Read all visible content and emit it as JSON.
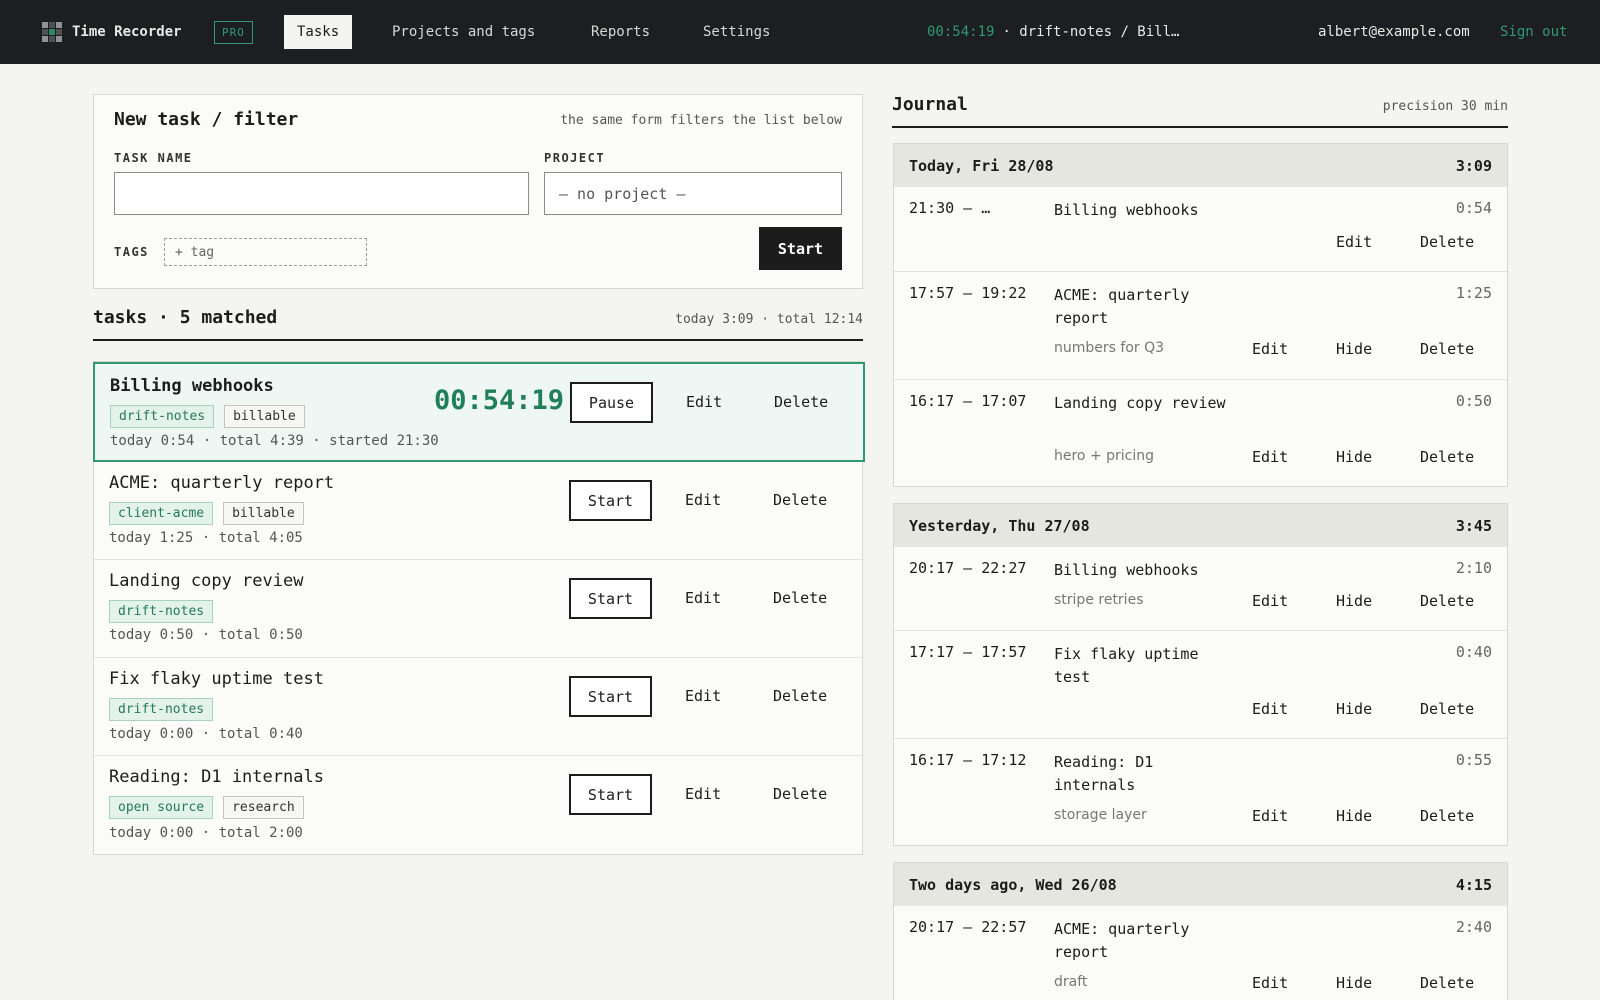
{
  "app": {
    "name": "Time Recorder",
    "badge": "PRO",
    "nav": [
      "Tasks",
      "Projects and tags",
      "Reports",
      "Settings"
    ],
    "running": {
      "time": "00:54:19",
      "label": "· drift-notes / Bill…"
    },
    "user": "albert@example.com",
    "signout": "Sign out",
    "colors": {
      "accent": "#2f9a70",
      "topbar": "#1c1e21"
    }
  },
  "form": {
    "title": "New task / filter",
    "hint": "the same form filters the list below",
    "task_label": "TASK NAME",
    "task_value": "",
    "project_label": "PROJECT",
    "project_value": "— no project —",
    "tags_label": "TAGS",
    "tags_placeholder": "+ tag",
    "start": "Start"
  },
  "tasks": {
    "heading": "tasks · 5 matched",
    "summary": "today 3:09 · total 12:14",
    "items": [
      {
        "name": "Billing webhooks",
        "tags": [
          "drift-notes",
          "billable"
        ],
        "meta": "today 0:54 · total 4:39 · started 21:30",
        "live": "00:54:19",
        "primary": "Pause",
        "edit": "Edit",
        "delete": "Delete"
      },
      {
        "name": "ACME: quarterly report",
        "tags": [
          "client-acme",
          "billable"
        ],
        "meta": "today 1:25 · total 4:05",
        "primary": "Start",
        "edit": "Edit",
        "delete": "Delete"
      },
      {
        "name": "Landing copy review",
        "tags": [
          "drift-notes"
        ],
        "meta": "today 0:50 · total 0:50",
        "primary": "Start",
        "edit": "Edit",
        "delete": "Delete"
      },
      {
        "name": "Fix flaky uptime test",
        "tags": [
          "drift-notes"
        ],
        "meta": "today 0:00 · total 0:40",
        "primary": "Start",
        "edit": "Edit",
        "delete": "Delete"
      },
      {
        "name": "Reading: D1 internals",
        "tags": [
          "open source",
          "research"
        ],
        "meta": "today 0:00 · total 2:00",
        "primary": "Start",
        "edit": "Edit",
        "delete": "Delete"
      }
    ]
  },
  "journal": {
    "title": "Journal",
    "precision": "precision 30 min",
    "days": [
      {
        "label": "Today, Fri 28/08",
        "total": "3:09",
        "entries": [
          {
            "time": "21:30 – …",
            "title": "Billing webhooks",
            "dur": "0:54",
            "note": "",
            "actions": [
              "Edit",
              "Delete"
            ]
          },
          {
            "time": "17:57 – 19:22",
            "title": "ACME: quarterly report",
            "dur": "1:25",
            "note": "numbers for Q3",
            "actions": [
              "Edit",
              "Hide",
              "Delete"
            ]
          },
          {
            "time": "16:17 – 17:07",
            "title": "Landing copy review",
            "dur": "0:50",
            "note": "hero + pricing",
            "actions": [
              "Edit",
              "Hide",
              "Delete"
            ]
          }
        ]
      },
      {
        "label": "Yesterday, Thu 27/08",
        "total": "3:45",
        "entries": [
          {
            "time": "20:17 – 22:27",
            "title": "Billing webhooks",
            "dur": "2:10",
            "note": "stripe retries",
            "actions": [
              "Edit",
              "Hide",
              "Delete"
            ]
          },
          {
            "time": "17:17 – 17:57",
            "title": "Fix flaky uptime test",
            "dur": "0:40",
            "note": "",
            "actions": [
              "Edit",
              "Hide",
              "Delete"
            ]
          },
          {
            "time": "16:17 – 17:12",
            "title": "Reading: D1 internals",
            "dur": "0:55",
            "note": "storage layer",
            "actions": [
              "Edit",
              "Hide",
              "Delete"
            ]
          }
        ]
      },
      {
        "label": "Two days ago, Wed 26/08",
        "total": "4:15",
        "entries": [
          {
            "time": "20:17 – 22:57",
            "title": "ACME: quarterly report",
            "dur": "2:40",
            "note": "draft",
            "actions": [
              "Edit",
              "Hide",
              "Delete"
            ]
          }
        ]
      }
    ]
  }
}
